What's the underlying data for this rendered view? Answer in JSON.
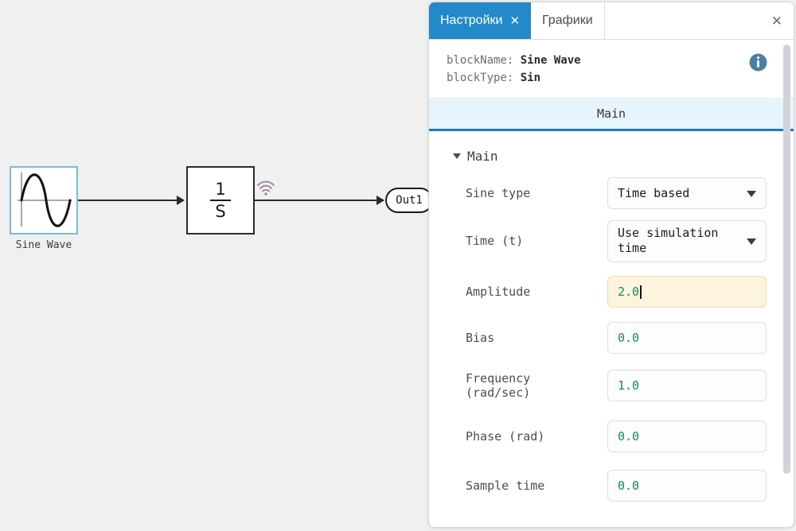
{
  "canvas": {
    "blocks": [
      {
        "name": "Sine Wave",
        "label": "Sine Wave",
        "icon": "sine-wave-icon",
        "selected": true
      },
      {
        "name": "Integrator",
        "numerator": "1",
        "denominator": "S",
        "icon": "wifi-signal-icon"
      },
      {
        "name": "Out1",
        "label": "Out1"
      }
    ],
    "background_color": "#f0f0f0",
    "selection_color": "#7ab8e0"
  },
  "panel": {
    "tabs": [
      {
        "label": "Настройки",
        "active": true,
        "closable": true,
        "close_glyph": "✕"
      },
      {
        "label": "Графики",
        "active": false,
        "closable": false
      }
    ],
    "close_glyph": "✕",
    "accent_color": "#2389c8",
    "meta": {
      "block_name_label": "blockName: ",
      "block_name_value": "Sine Wave",
      "block_type_label": "blockType: ",
      "block_type_value": "Sin",
      "info_icon": "info-icon"
    },
    "section_tabs": [
      {
        "label": "Main",
        "active": true
      }
    ],
    "group": {
      "label": "Main",
      "expanded": true,
      "collapse_glyph": "▼"
    },
    "fields": [
      {
        "label": "Sine type",
        "name": "sine-type",
        "type": "select",
        "value": "Time based",
        "focused": false
      },
      {
        "label": "Time (t)",
        "name": "time-t",
        "type": "select",
        "value": "Use simulation time",
        "focused": false
      },
      {
        "label": "Amplitude",
        "name": "amplitude",
        "type": "input",
        "value": "2.0",
        "focused": true
      },
      {
        "label": "Bias",
        "name": "bias",
        "type": "input",
        "value": "0.0",
        "focused": false
      },
      {
        "label": "Frequency\n(rad/sec)",
        "name": "frequency",
        "type": "input",
        "value": "1.0",
        "focused": false
      },
      {
        "label": "Phase (rad)",
        "name": "phase",
        "type": "input",
        "value": "0.0",
        "focused": false
      },
      {
        "label": "Sample time",
        "name": "sample-time",
        "type": "input",
        "value": "0.0",
        "focused": false
      }
    ],
    "value_color": "#0f8a5f",
    "focused_field_bg": "#fdf4dd"
  }
}
